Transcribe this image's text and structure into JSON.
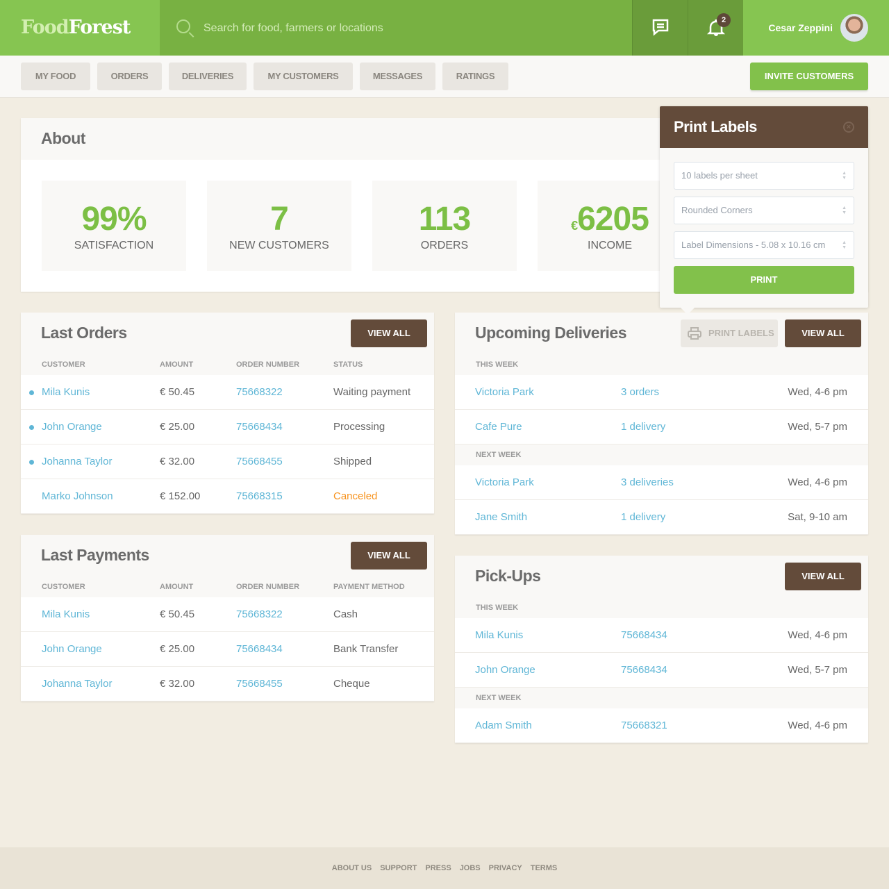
{
  "brand": {
    "part1": "Food",
    "part2": "Forest"
  },
  "search": {
    "placeholder": "Search for food, farmers or locations"
  },
  "header": {
    "notifications_count": "2",
    "user_name": "Cesar Zeppini"
  },
  "nav": {
    "items": [
      "MY FOOD",
      "ORDERS",
      "DELIVERIES",
      "MY CUSTOMERS",
      "MESSAGES",
      "RATINGS"
    ],
    "invite": "INVITE CUSTOMERS"
  },
  "about": {
    "title": "About",
    "stats": [
      {
        "value": "99%",
        "label": "SATISFACTION"
      },
      {
        "value": "7",
        "label": "NEW CUSTOMERS"
      },
      {
        "value": "113",
        "label": "ORDERS"
      },
      {
        "currency": "€",
        "value": "6205",
        "label": "INCOME"
      }
    ]
  },
  "last_orders": {
    "title": "Last Orders",
    "view_all": "VIEW ALL",
    "columns": [
      "CUSTOMER",
      "AMOUNT",
      "ORDER NUMBER",
      "STATUS"
    ],
    "rows": [
      {
        "customer": "Mila Kunis",
        "amount": "€ 50.45",
        "order": "75668322",
        "status": "Waiting payment",
        "unread": true
      },
      {
        "customer": "John Orange",
        "amount": "€ 25.00",
        "order": "75668434",
        "status": "Processing",
        "unread": true
      },
      {
        "customer": "Johanna Taylor",
        "amount": "€ 32.00",
        "order": "75668455",
        "status": "Shipped",
        "unread": true
      },
      {
        "customer": "Marko Johnson",
        "amount": "€ 152.00",
        "order": "75668315",
        "status": "Canceled",
        "unread": false
      }
    ]
  },
  "last_payments": {
    "title": "Last Payments",
    "view_all": "VIEW ALL",
    "columns": [
      "CUSTOMER",
      "AMOUNT",
      "ORDER NUMBER",
      "PAYMENT METHOD"
    ],
    "rows": [
      {
        "customer": "Mila Kunis",
        "amount": "€ 50.45",
        "order": "75668322",
        "method": "Cash"
      },
      {
        "customer": "John Orange",
        "amount": "€ 25.00",
        "order": "75668434",
        "method": "Bank Transfer"
      },
      {
        "customer": "Johanna Taylor",
        "amount": "€ 32.00",
        "order": "75668455",
        "method": "Cheque"
      }
    ]
  },
  "deliveries": {
    "title": "Upcoming Deliveries",
    "print_labels": "PRINT LABELS",
    "view_all": "VIEW ALL",
    "groups": [
      {
        "label": "THIS WEEK",
        "rows": [
          {
            "name": "Victoria Park",
            "info": "3 orders",
            "time": "Wed, 4-6 pm"
          },
          {
            "name": "Cafe Pure",
            "info": "1 delivery",
            "time": "Wed, 5-7 pm"
          }
        ]
      },
      {
        "label": "NEXT WEEK",
        "rows": [
          {
            "name": "Victoria Park",
            "info": "3 deliveries",
            "time": "Wed, 4-6 pm"
          },
          {
            "name": "Jane Smith",
            "info": "1 delivery",
            "time": "Sat, 9-10 am"
          }
        ]
      }
    ]
  },
  "pickups": {
    "title": "Pick-Ups",
    "view_all": "VIEW ALL",
    "groups": [
      {
        "label": "THIS WEEK",
        "rows": [
          {
            "name": "Mila Kunis",
            "info": "75668434",
            "time": "Wed, 4-6 pm"
          },
          {
            "name": "John Orange",
            "info": "75668434",
            "time": "Wed, 5-7 pm"
          }
        ]
      },
      {
        "label": "NEXT WEEK",
        "rows": [
          {
            "name": "Adam Smith",
            "info": "75668321",
            "time": "Wed, 4-6 pm"
          }
        ]
      }
    ]
  },
  "print_popup": {
    "title": "Print Labels",
    "selects": [
      "10 labels per sheet",
      "Rounded Corners",
      "Label Dimensions - 5.08 x 10.16 cm"
    ],
    "print": "PRINT"
  },
  "footer": {
    "links": [
      "ABOUT US",
      "SUPPORT",
      "PRESS",
      "JOBS",
      "PRIVACY",
      "TERMS"
    ]
  },
  "colors": {
    "green": "#82c14b",
    "brown": "#634b3a",
    "link": "#5fb6d6",
    "canceled": "#f7931e"
  }
}
